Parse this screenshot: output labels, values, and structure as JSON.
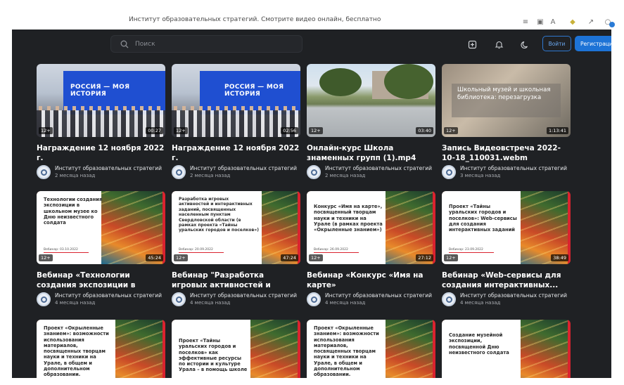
{
  "browser": {
    "title": "Институт образовательных стратегий. Смотрите видео онлайн, бесплатно"
  },
  "header": {
    "search_placeholder": "Поиск",
    "login_label": "Войти",
    "register_label": "Регистрация"
  },
  "colors": {
    "background": "#1f2124",
    "accent": "#1d73d6",
    "webinar_edge": "#d9232f"
  },
  "videos": [
    {
      "title": "Награждение 12 ноября 2022 г.",
      "channel": "Институт образовательных стратегий",
      "date": "2 месяца назад",
      "age": "12+",
      "duration": "00:27",
      "thumb_text": "РОССИЯ — МОЯ ИСТОРИЯ"
    },
    {
      "title": "Награждение 12 ноября 2022 г.",
      "channel": "Институт образовательных стратегий",
      "date": "2 месяца назад",
      "age": "12+",
      "duration": "02:56",
      "thumb_text": "РОССИЯ — МОЯ ИСТОРИЯ"
    },
    {
      "title": "Онлайн-курс Школа знаменных групп (1).mp4",
      "channel": "Институт образовательных стратегий",
      "date": "2 месяца назад",
      "age": "12+",
      "duration": "03:40"
    },
    {
      "title": "Запись Видеовстреча 2022-10-18_110031.webm",
      "channel": "Институт образовательных стратегий",
      "date": "3 месяца назад",
      "age": "12+",
      "duration": "1:13:41",
      "thumb_text": "Школьный музей и школьная библиотека: перезагрузка"
    },
    {
      "title": "Вебинар «Технологии создания экспозиции в школьном музее к...",
      "channel": "Институт образовательных стратегий",
      "date": "4 месяца назад",
      "age": "12+",
      "duration": "45:24",
      "thumb_text": "Технологии создания экспозиции в школьном музее ко Дню неизвестного солдата",
      "thumb_date": "Вебинар: 03.10.2022"
    },
    {
      "title": "Вебинар \"Разработка игровых активностей и интерактивных...",
      "channel": "Институт образовательных стратегий",
      "date": "4 месяца назад",
      "age": "12+",
      "duration": "47:24",
      "thumb_text": "Разработка игровых активностей и интерактивных заданий, посвященных населенным пунктам Свердловской области (в рамках проекта «Тайны уральских городов и поселков»)",
      "thumb_date": "Вебинар: 20.09.2022"
    },
    {
      "title": "Вебинар «Конкурс «Имя на карте»",
      "channel": "Институт образовательных стратегий",
      "date": "4 месяца назад",
      "age": "12+",
      "duration": "27:12",
      "thumb_text": "Конкурс «Имя на карте», посвященный творцам науки и техники на Урале (в рамках проекта «Окрыленные знанием»)",
      "thumb_date": "Вебинар: 26.09.2022"
    },
    {
      "title": "Вебинар «Web-сервисы для создания интерактивных...",
      "channel": "Институт образовательных стратегий",
      "date": "4 месяца назад",
      "age": "12+",
      "duration": "38:49",
      "thumb_text": "Проект «Тайны уральских городов и поселков»: Web-сервисы для создания интерактивных заданий",
      "thumb_date": "Вебинар: 23.09.2022"
    },
    {
      "thumb_text": "Проект «Окрыленные знанием»: возможности использования материалов, посвященных творцам науки и техники на Урале, в общем и дополнительном образовании."
    },
    {
      "thumb_text": "Проект «Тайны уральских городов и поселков» как эффективные ресурсы по истории и культуре Урала – в помощь школе"
    },
    {
      "thumb_text": "Проект «Окрыленные знанием»: возможности использования материалов, посвященных творцам науки и техники на Урале, в общем и дополнительном образовании."
    },
    {
      "thumb_text": "Создание музейной экспозиции, посвященной Дню неизвестного солдата"
    }
  ]
}
